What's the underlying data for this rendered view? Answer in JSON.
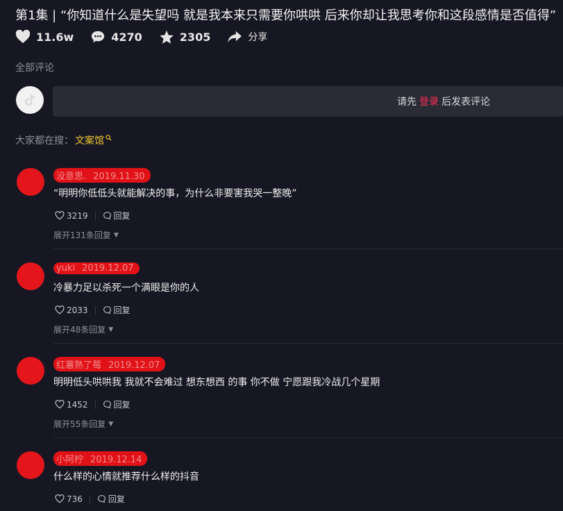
{
  "video": {
    "title": "第1集 |  “你知道什么是失望吗 就是我本来只需要你哄哄 后来你却让我思考你和这段感情是否值得”",
    "likes": "11.6w",
    "comments": "4270",
    "favorites": "2305",
    "share_label": "分享"
  },
  "comments_section": {
    "label": "全部评论",
    "login_prompt_prefix": "请先",
    "login_link": "登录",
    "login_prompt_suffix": "后发表评论"
  },
  "hot_search": {
    "label": "大家都在搜：",
    "keyword": "文案馆"
  },
  "comment_list": [
    {
      "name": "没意思.",
      "date": "2019.11.30",
      "text": "“明明你低低头就能解决的事，为什么非要害我哭一整晚”",
      "likes": "3219",
      "reply_label": "回复",
      "expand": "展开131条回复"
    },
    {
      "name": "yuki",
      "date": "2019.12.07",
      "text": "冷暴力足以杀死一个满眼是你的人",
      "likes": "2033",
      "reply_label": "回复",
      "expand": "展开48条回复"
    },
    {
      "name": "红薯熟了莓",
      "date": "2019.12.07",
      "text": "明明低头哄哄我 我就不会难过 想东想西 的事 你不做 宁愿跟我冷战几个星期",
      "likes": "1452",
      "reply_label": "回复",
      "expand": "展开55条回复"
    },
    {
      "name": "小阿柠",
      "date": "2019.12.14",
      "text": "什么样的心情就推荐什么样的抖音",
      "likes": "736",
      "reply_label": "回复",
      "expand": ""
    }
  ],
  "colors": {
    "accent": "#fe2c55",
    "keyword": "#f5c832",
    "background": "#161722"
  }
}
